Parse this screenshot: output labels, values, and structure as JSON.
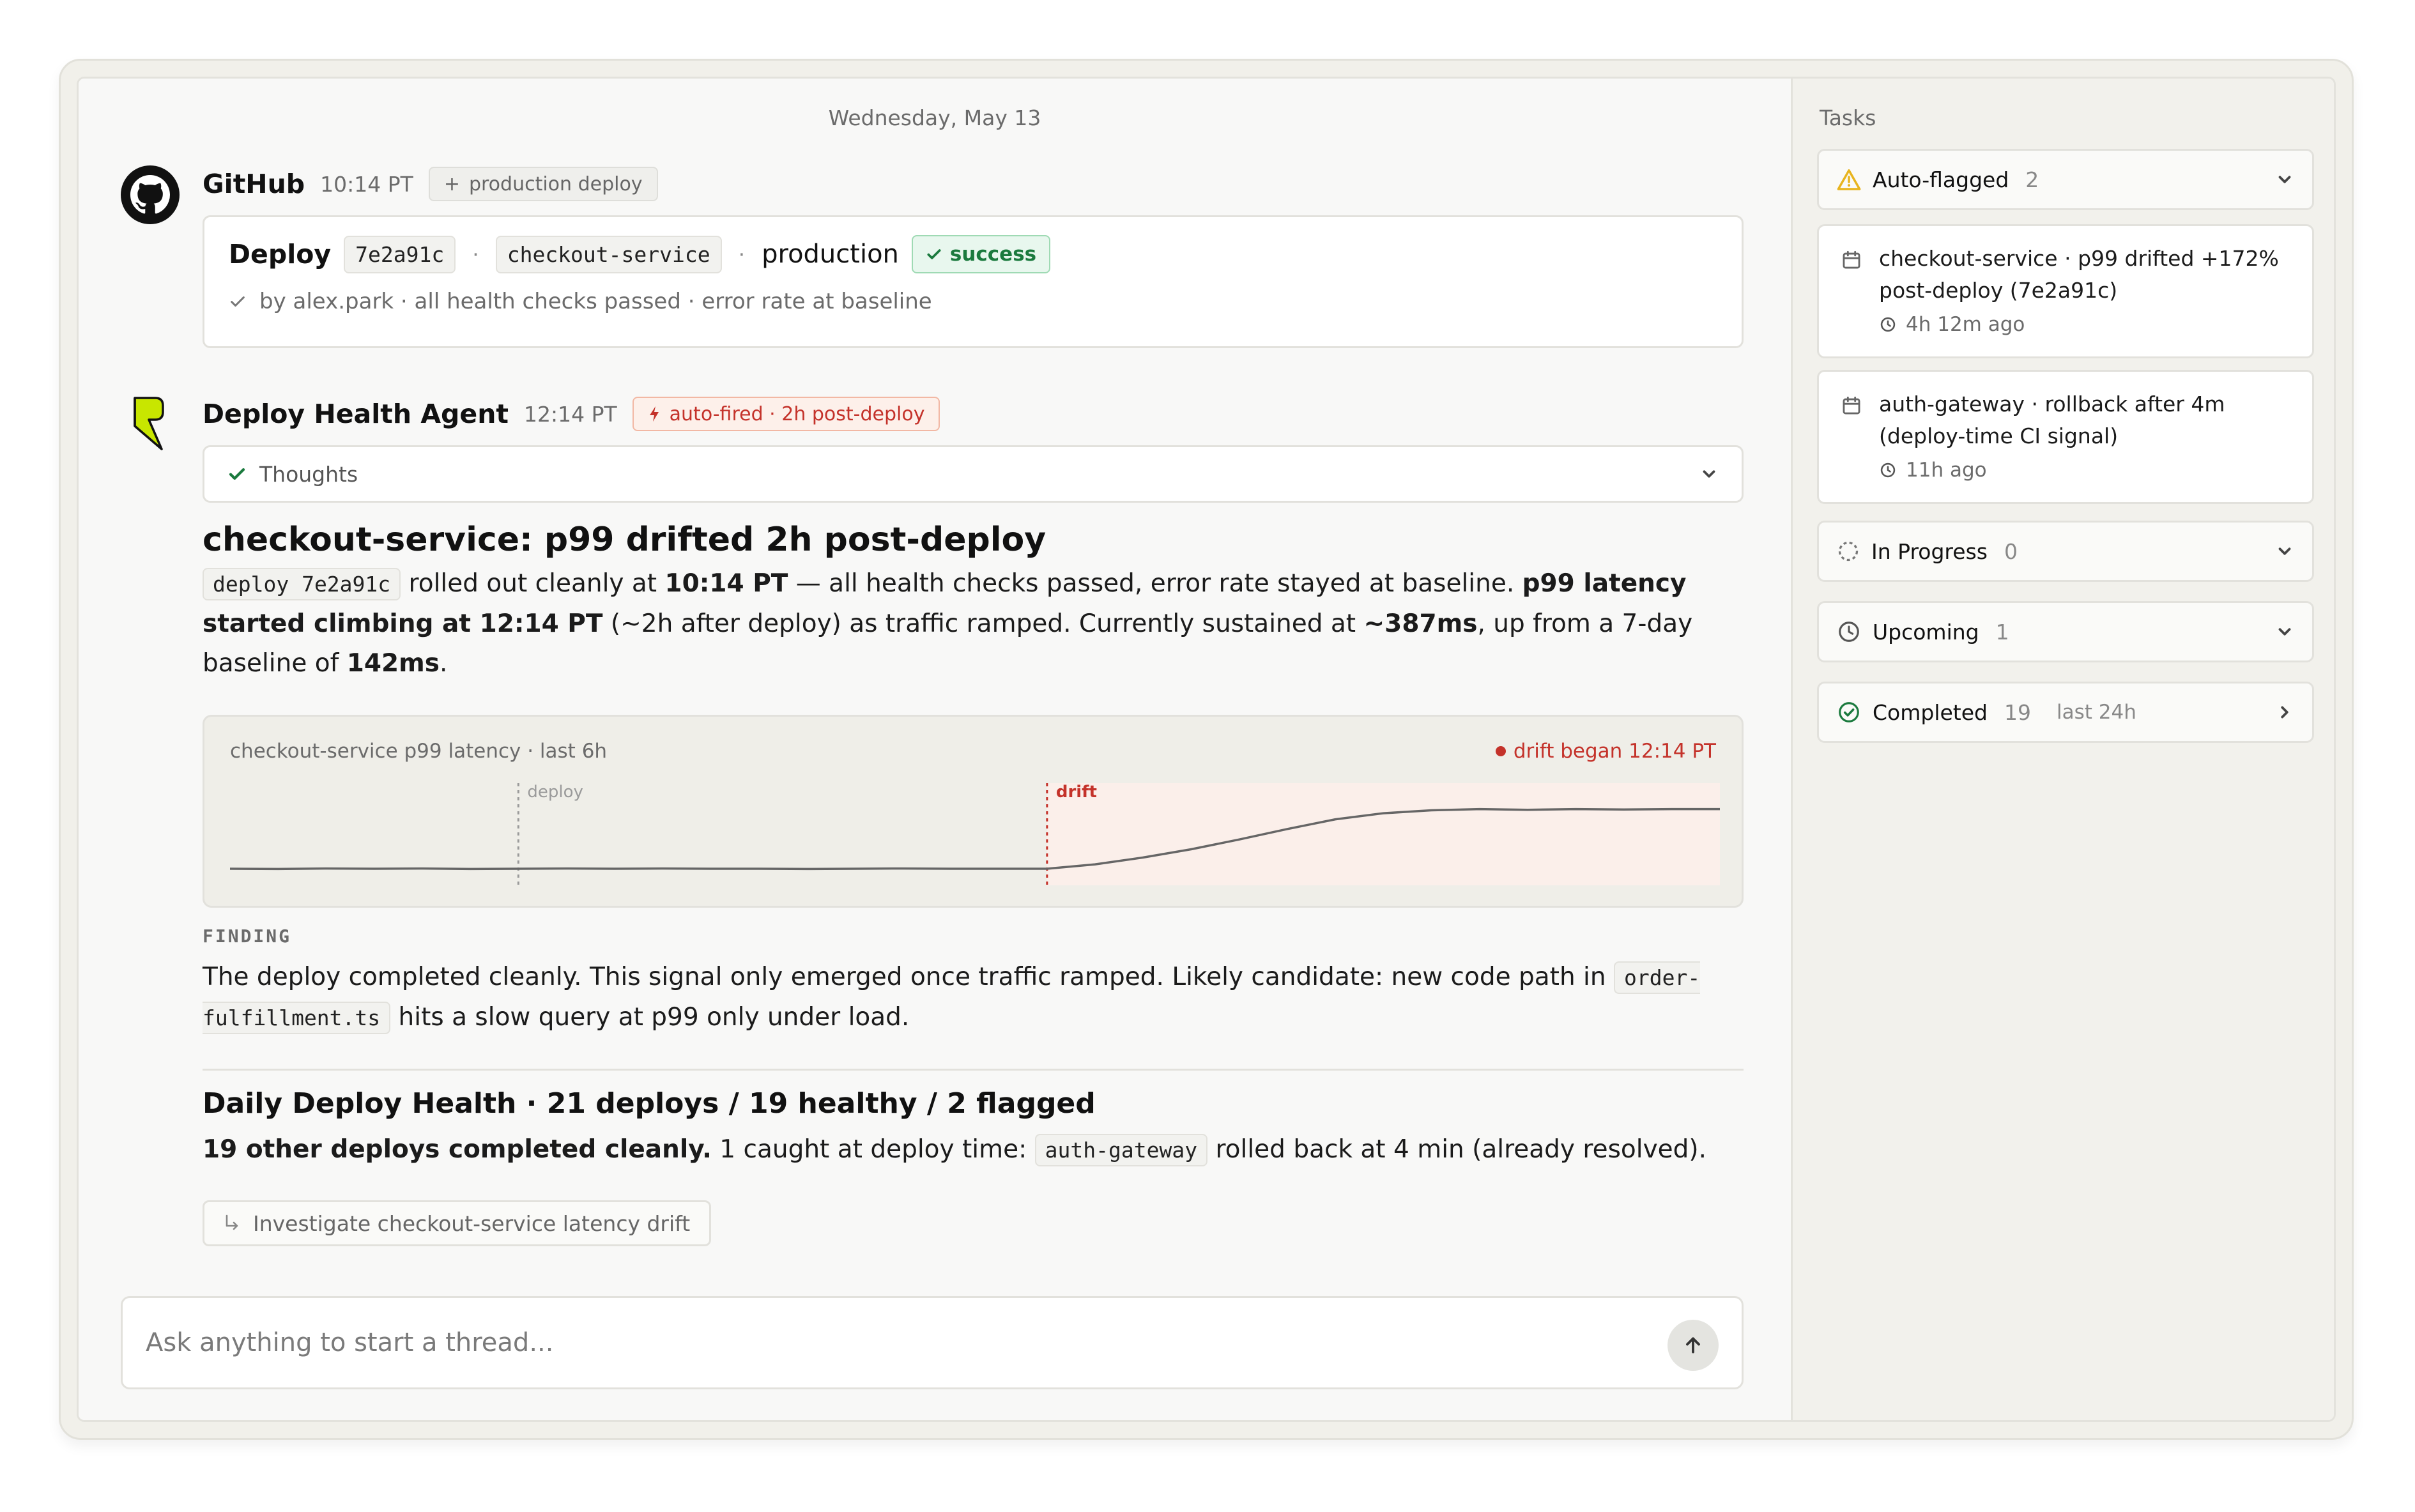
{
  "date_header": "Wednesday, May 13",
  "github_msg": {
    "author": "GitHub",
    "time": "10:14 PT",
    "tag": "production deploy",
    "deploy_label": "Deploy",
    "commit": "7e2a91c",
    "sep": "·",
    "service": "checkout-service",
    "environment": "production",
    "status": "success",
    "summary": "by alex.park · all health checks passed · error rate at baseline"
  },
  "agent_msg": {
    "author": "Deploy Health Agent",
    "time": "12:14 PT",
    "tag": "auto-fired · 2h post-deploy",
    "thoughts_label": "Thoughts",
    "title": "checkout-service: p99 drifted 2h post-deploy",
    "intro": {
      "code": "deploy 7e2a91c",
      "t1": " rolled out cleanly at ",
      "b1": "10:14 PT",
      "t2": " — all health checks passed, error rate stayed at baseline. ",
      "b2": "p99 latency started climbing at 12:14 PT",
      "t3": " (~2h after deploy) as traffic ramped. Currently sustained at ",
      "b3": "~387ms",
      "t4": ", up from a 7-day baseline of ",
      "b4": "142ms",
      "t5": "."
    },
    "chart_title": "checkout-service p99 latency · last 6h",
    "chart_drift_label": "drift began 12:14 PT",
    "finding_label": "FINDING",
    "finding": {
      "t1": "The deploy completed cleanly. This signal only emerged once traffic ramped. Likely candidate: new code path in ",
      "code": "order-fulfillment.ts",
      "t2": " hits a slow query at p99 only under load."
    },
    "summary_title": "Daily Deploy Health · 21 deploys / 19 healthy / 2 flagged",
    "summary": {
      "b1": "19 other deploys completed cleanly.",
      "t1": " 1 caught at deploy time: ",
      "code": "auth-gateway",
      "t2": " rolled back at 4 min (already resolved)."
    },
    "followup_label": "Investigate checkout-service latency drift"
  },
  "composer": {
    "placeholder": "Ask anything to start a thread..."
  },
  "tasks_panel": {
    "title": "Tasks",
    "groups": [
      {
        "label": "Auto-flagged",
        "count": "2",
        "icon": "warning-icon"
      },
      {
        "label": "In Progress",
        "count": "0",
        "icon": "dashed-circle-icon"
      },
      {
        "label": "Upcoming",
        "count": "1",
        "icon": "clock-icon"
      },
      {
        "label": "Completed",
        "count": "19",
        "extra": "last 24h",
        "icon": "check-circle-icon"
      }
    ],
    "auto_flagged_items": [
      {
        "text": "checkout-service · p99 drifted +172% post-deploy (7e2a91c)",
        "age": "4h 12m ago"
      },
      {
        "text": "auth-gateway · rollback after 4m (deploy-time CI signal)",
        "age": "11h ago"
      }
    ]
  },
  "colors": {
    "accent_red": "#c4322a",
    "success_green": "#1b7a3e",
    "warning_yellow": "#e8b41e",
    "agent_logo": "#c8e600"
  },
  "chart_data": {
    "type": "line",
    "title": "checkout-service p99 latency · last 6h",
    "unit": "ms",
    "annotations": [
      {
        "label": "deploy",
        "index": 6,
        "color": "#9a9a9a"
      },
      {
        "label": "drift",
        "index": 17,
        "color": "#c4322a"
      }
    ],
    "values": [
      142,
      141,
      143,
      142,
      143,
      141,
      142,
      143,
      142,
      143,
      142,
      142,
      141,
      142,
      143,
      142,
      142,
      142,
      160,
      188,
      222,
      262,
      305,
      345,
      370,
      382,
      387,
      384,
      387,
      385,
      387,
      387
    ],
    "ylim": [
      100,
      420
    ],
    "grid": false,
    "legend": "none"
  }
}
